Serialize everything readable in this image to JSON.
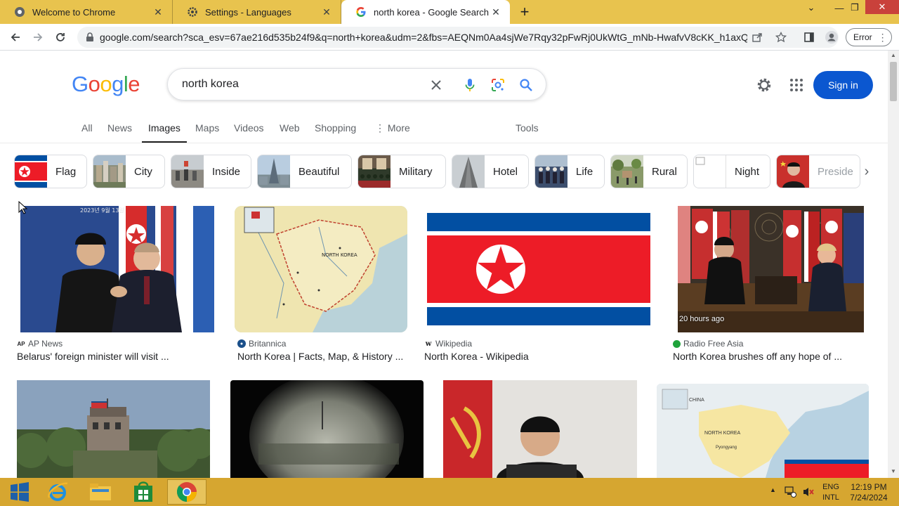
{
  "browser": {
    "tabs": [
      {
        "title": "Welcome to Chrome",
        "active": false
      },
      {
        "title": "Settings - Languages",
        "active": false
      },
      {
        "title": "north korea - Google Search",
        "active": true
      }
    ],
    "url": "google.com/search?sca_esv=67ae216d535b24f9&q=north+korea&udm=2&fbs=AEQNm0Aa4sjWe7Rqy32pFwRj0UkWtG_mNb-HwafvV8cKK_h1axQ...",
    "error_label": "Error",
    "colors": {
      "tabstrip": "#e8c34e",
      "close": "#c9413b"
    }
  },
  "google": {
    "logo": {
      "letters": [
        "G",
        "o",
        "o",
        "g",
        "l",
        "e"
      ],
      "colors": [
        "#4285f4",
        "#ea4335",
        "#fbbc05",
        "#4285f4",
        "#34a853",
        "#ea4335"
      ]
    },
    "query": "north korea",
    "signin_label": "Sign in",
    "nav_tabs": [
      "All",
      "News",
      "Images",
      "Maps",
      "Videos",
      "Web",
      "Shopping",
      "More",
      "Tools"
    ],
    "selected_tab": "Images",
    "chips": [
      "Flag",
      "City",
      "Inside",
      "Beautiful",
      "Military",
      "Hotel",
      "Life",
      "Rural",
      "Night",
      "Preside"
    ],
    "results": [
      {
        "source": "AP News",
        "caption": "Belarus' foreign minister will visit ...",
        "badge": ""
      },
      {
        "source": "Britannica",
        "caption": "North Korea | Facts, Map, & History ...",
        "badge": ""
      },
      {
        "source": "Wikipedia",
        "caption": "North Korea - Wikipedia",
        "badge": ""
      },
      {
        "source": "Radio Free Asia",
        "caption": "North Korea brushes off any hope of ...",
        "badge": "20 hours ago"
      }
    ],
    "map_labels": {
      "china": "CHINA",
      "north_korea": "NORTH KOREA",
      "pyongyang": "Pyongyang"
    }
  },
  "taskbar": {
    "lang_line1": "ENG",
    "lang_line2": "INTL",
    "time": "12:19 PM",
    "date": "7/24/2024"
  }
}
